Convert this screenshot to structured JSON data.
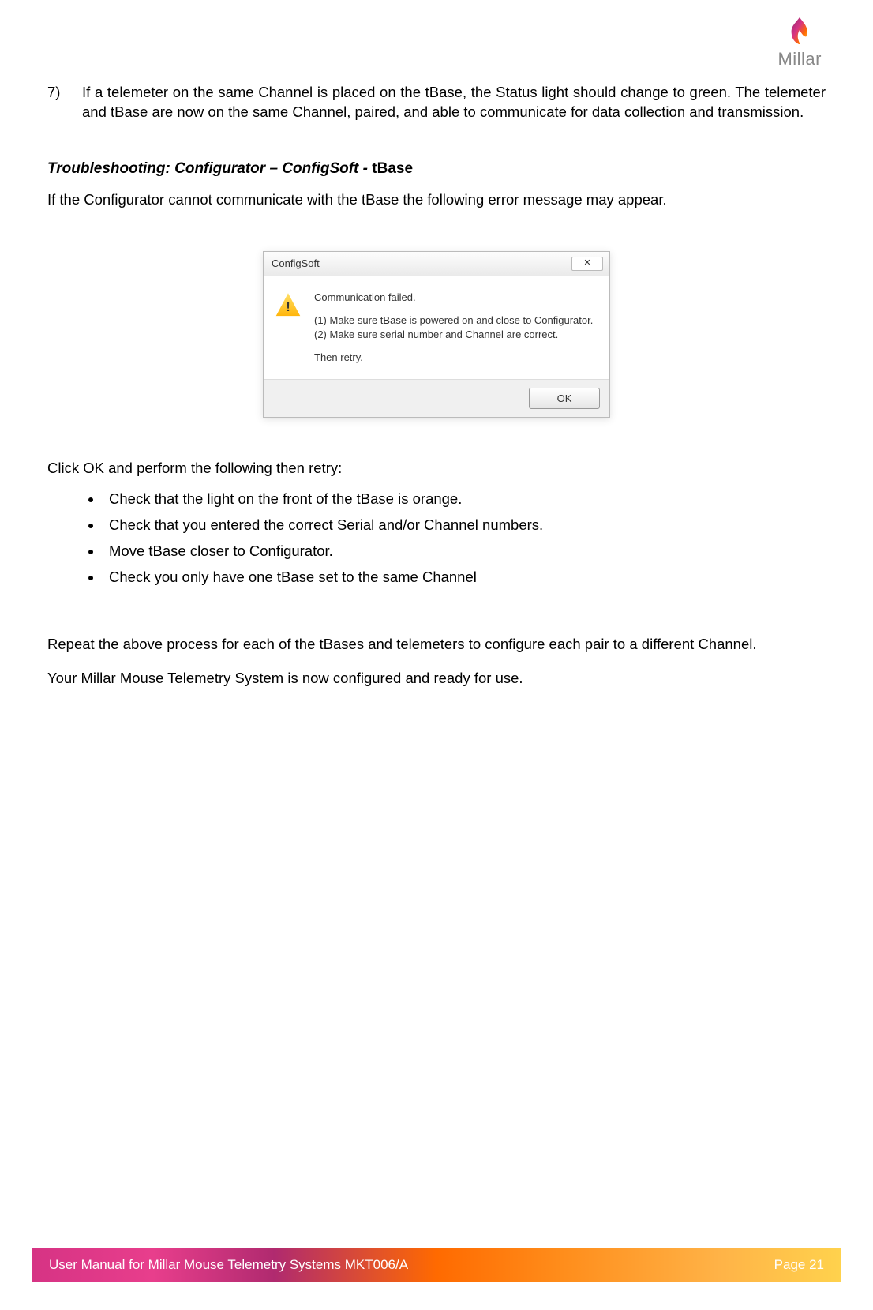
{
  "logo": {
    "text": "Millar"
  },
  "list_item": {
    "number": "7)",
    "text": "If a telemeter on the same Channel is placed on the tBase, the Status light should change to green.  The telemeter and tBase are now on the same Channel, paired, and able to communicate for data collection and transmission."
  },
  "section": {
    "prefix": "Troubleshooting: Configurator – ConfigSoft - ",
    "suffix": "tBase",
    "intro": "If the Configurator cannot communicate with the tBase the following error message may appear."
  },
  "dialog": {
    "title": "ConfigSoft",
    "close": "✕",
    "message": "Communication failed.",
    "step1": "(1) Make sure tBase is powered on and close to Configurator.",
    "step2": "(2) Make sure serial number and Channel are correct.",
    "retry": "Then retry.",
    "ok": "OK"
  },
  "after_dialog": "Click OK and perform the following then retry:",
  "bullets": [
    "Check that the light on the front of the tBase is orange.",
    "Check that you entered the correct Serial and/or Channel numbers.",
    "Move tBase closer to Configurator.",
    "Check you only have one tBase set to the same Channel"
  ],
  "closing1": "Repeat the above process for each of the tBases and telemeters to configure each pair to a different Channel.",
  "closing2": "Your Millar Mouse Telemetry System is now configured and ready for use.",
  "footer": {
    "left": "User Manual for Millar Mouse Telemetry Systems MKT006/A",
    "right": "Page 21"
  }
}
